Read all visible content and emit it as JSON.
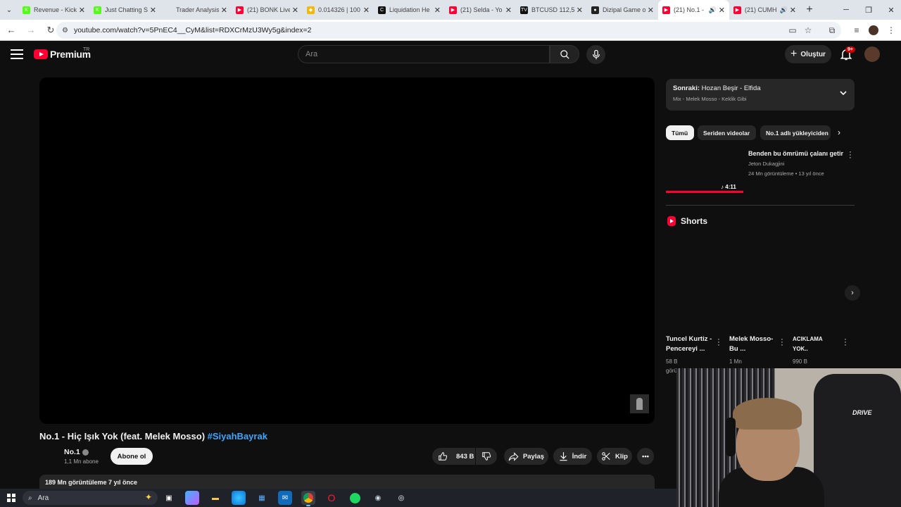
{
  "browser": {
    "tabs": [
      {
        "title": "Revenue - Kick",
        "fav_color": "#53fc18",
        "fav_text": "K"
      },
      {
        "title": "Just Chatting S",
        "fav_color": "#53fc18",
        "fav_text": "K"
      },
      {
        "title": "Trader Analysis",
        "fav_color": "#dfe3ea",
        "fav_text": ""
      },
      {
        "title": "(21) BONK Live",
        "fav_color": "#ff0033",
        "fav_text": "▶"
      },
      {
        "title": "0.014326 | 100",
        "fav_color": "#f0b90b",
        "fav_text": "◆"
      },
      {
        "title": "Liquidation He",
        "fav_color": "#111111",
        "fav_text": "C"
      },
      {
        "title": "(21) Selda - Yo",
        "fav_color": "#ff0033",
        "fav_text": "▶"
      },
      {
        "title": "BTCUSD 112,5",
        "fav_color": "#111111",
        "fav_text": "TV"
      },
      {
        "title": "Dizipal Game o",
        "fav_color": "#222222",
        "fav_text": "●"
      },
      {
        "title": "(21) No.1 -",
        "fav_color": "#ff0033",
        "fav_text": "▶",
        "active": true,
        "audio": true
      },
      {
        "title": "(21) CUMH",
        "fav_color": "#ff0033",
        "fav_text": "▶",
        "audio": true
      }
    ],
    "url": "youtube.com/watch?v=5PnEC4__CyM&list=RDXCrMzU3Wy5g&index=2"
  },
  "masthead": {
    "logo_text": "Premium",
    "region": "TR",
    "search_placeholder": "Ara",
    "create_label": "Oluştur",
    "notif_badge": "9+"
  },
  "video": {
    "title": "No.1 - Hiç Işık Yok (feat. Melek Mosso) ",
    "hashtag": "#SiyahBayrak",
    "channel": "No.1",
    "subscribers": "1,1 Mn abone",
    "subscribe_label": "Abone ol",
    "likes": "843 B",
    "share_label": "Paylaş",
    "download_label": "İndir",
    "clip_label": "Klip",
    "description_stats": "189 Mn görüntüleme  7 yıl önce"
  },
  "sidebar": {
    "up_next": {
      "prefix": "Sonraki:",
      "title": "Hozan Beşir - Elfida",
      "subtitle": "Mix - Melek Mosso - Keklik Gibi"
    },
    "chips": [
      "Tümü",
      "Seriden videolar",
      "No.1 adlı yükleyiciden"
    ],
    "rec": {
      "title": "Benden bu ömrümü çalanı getir",
      "channel": "Jeton Dukagjini",
      "meta": "24 Mn görüntüleme • 13 yıl önce",
      "duration": "4:11",
      "progress": 1.0
    },
    "shorts_title": "Shorts",
    "shorts": [
      {
        "title": "Tuncel Kurtiz - Pencereyi ...",
        "views": "58 B",
        "views_suffix": "görü..."
      },
      {
        "title": "Melek Mosso-Bu ...",
        "views": "1 Mn",
        "views_suffix": ""
      },
      {
        "title": "ACIKLAMA YOK..",
        "views": "990 B",
        "views_suffix": ""
      }
    ]
  },
  "webcam": {
    "chair_brand": "DRIVE"
  },
  "taskbar": {
    "search_label": "Ara"
  }
}
